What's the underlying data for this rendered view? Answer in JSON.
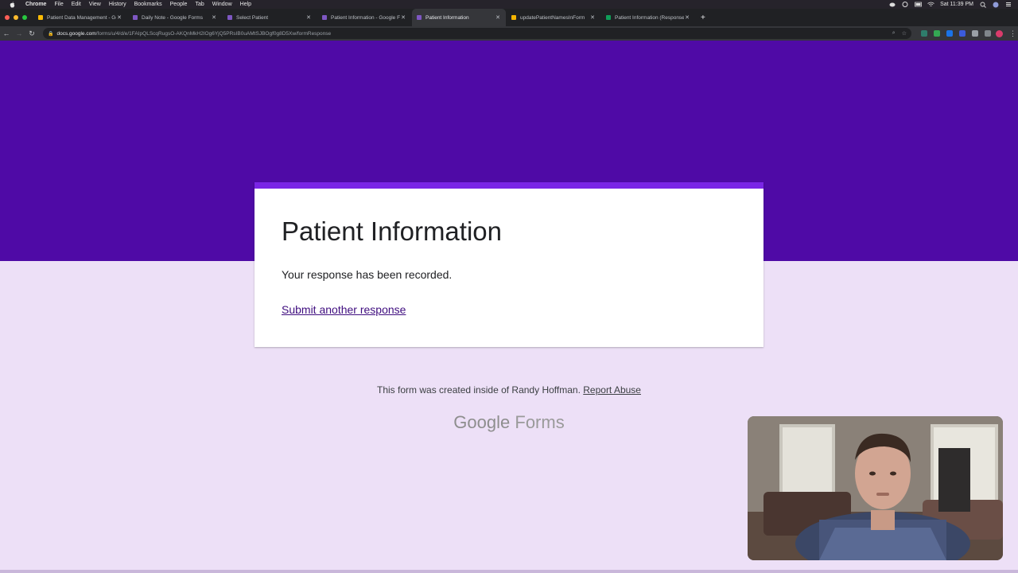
{
  "menubar": {
    "app": "Chrome",
    "items": [
      "File",
      "Edit",
      "View",
      "History",
      "Bookmarks",
      "People",
      "Tab",
      "Window",
      "Help"
    ],
    "clock": "Sat 11:39 PM"
  },
  "tabs": [
    {
      "title": "Patient Data Management - Go...",
      "favicon_color": "#fbbc04",
      "active": false
    },
    {
      "title": "Daily Note - Google Forms",
      "favicon_color": "#7e57c2",
      "active": false
    },
    {
      "title": "Select Patient",
      "favicon_color": "#7e57c2",
      "active": false
    },
    {
      "title": "Patient Information - Google Fo...",
      "favicon_color": "#7e57c2",
      "active": false
    },
    {
      "title": "Patient Information",
      "favicon_color": "#7e57c2",
      "active": true
    },
    {
      "title": "updatePatientNamesInForm",
      "favicon_color": "#f4b400",
      "active": false
    },
    {
      "title": "Patient Information (Responses...",
      "favicon_color": "#0f9d58",
      "active": false
    }
  ],
  "address": {
    "host": "docs.google.com",
    "path": "/forms/u/4/d/e/1FAIpQLScqRugsO-AKQnMkH2IOg6YjQ5PRsIB0uAMtSJBOgf0g8D5Xw/formResponse"
  },
  "form": {
    "title": "Patient Information",
    "confirmation": "Your response has been recorded.",
    "submit_another": "Submit another response"
  },
  "footer": {
    "created_text": "This form was created inside of Randy Hoffman.",
    "report_abuse": "Report Abuse",
    "logo_google": "Google",
    "logo_forms": "Forms"
  },
  "colors": {
    "banner": "#4f0aa6",
    "card_accent": "#7a25e6",
    "background": "#ede0f7",
    "link": "#3f0d7f"
  }
}
